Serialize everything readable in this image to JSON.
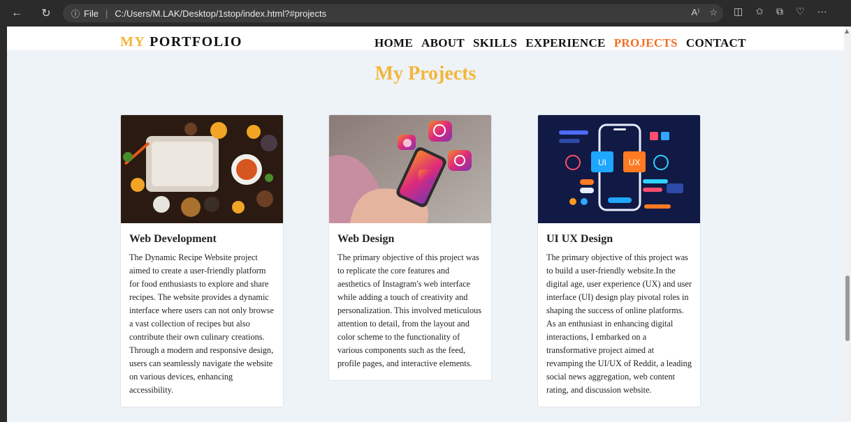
{
  "browser": {
    "back_icon": "←",
    "refresh_icon": "↻",
    "info_icon": "ⓘ",
    "file_label": "File",
    "separator": "|",
    "url": "C:/Users/M.LAK/Desktop/1stop/index.html?#projects",
    "read_aloud_icon": "A⁾",
    "favorite_icon": "☆",
    "split_icon": "◫",
    "favorites_icon": "✩",
    "collections_icon": "⧉",
    "heart_icon": "♡",
    "more_icon": "···"
  },
  "site": {
    "logo_my": "MY",
    "logo_rest": "PORTFOLIO",
    "nav": [
      "HOME",
      "ABOUT",
      "SKILLS",
      "EXPERIENCE",
      "PROJECTS",
      "CONTACT"
    ],
    "active_nav": "PROJECTS",
    "section_title": "My Projects"
  },
  "projects": [
    {
      "title": "Web Development",
      "text": "The Dynamic Recipe Website project aimed to create a user-friendly platform for food enthusiasts to explore and share recipes. The website provides a dynamic interface where users can not only browse a vast collection of recipes but also contribute their own culinary creations. Through a modern and responsive design, users can seamlessly navigate the website on various devices, enhancing accessibility."
    },
    {
      "title": "Web Design",
      "text": "The primary objective of this project was to replicate the core features and aesthetics of Instagram's web interface while adding a touch of creativity and personalization. This involved meticulous attention to detail, from the layout and color scheme to the functionality of various components such as the feed, profile pages, and interactive elements."
    },
    {
      "title": "UI UX Design",
      "text": "The primary objective of this project was to build a user-friendly website.In the digital age, user experience (UX) and user interface (UI) design play pivotal roles in shaping the success of online platforms. As an enthusiast in enhancing digital interactions, I embarked on a transformative project aimed at revamping the UI/UX of Reddit, a leading social news aggregation, web content rating, and discussion website."
    }
  ],
  "ui_labels": {
    "ui": "UI",
    "ux": "UX"
  },
  "colors": {
    "accent_gold": "#f4b63a",
    "accent_orange": "#f26d21"
  }
}
